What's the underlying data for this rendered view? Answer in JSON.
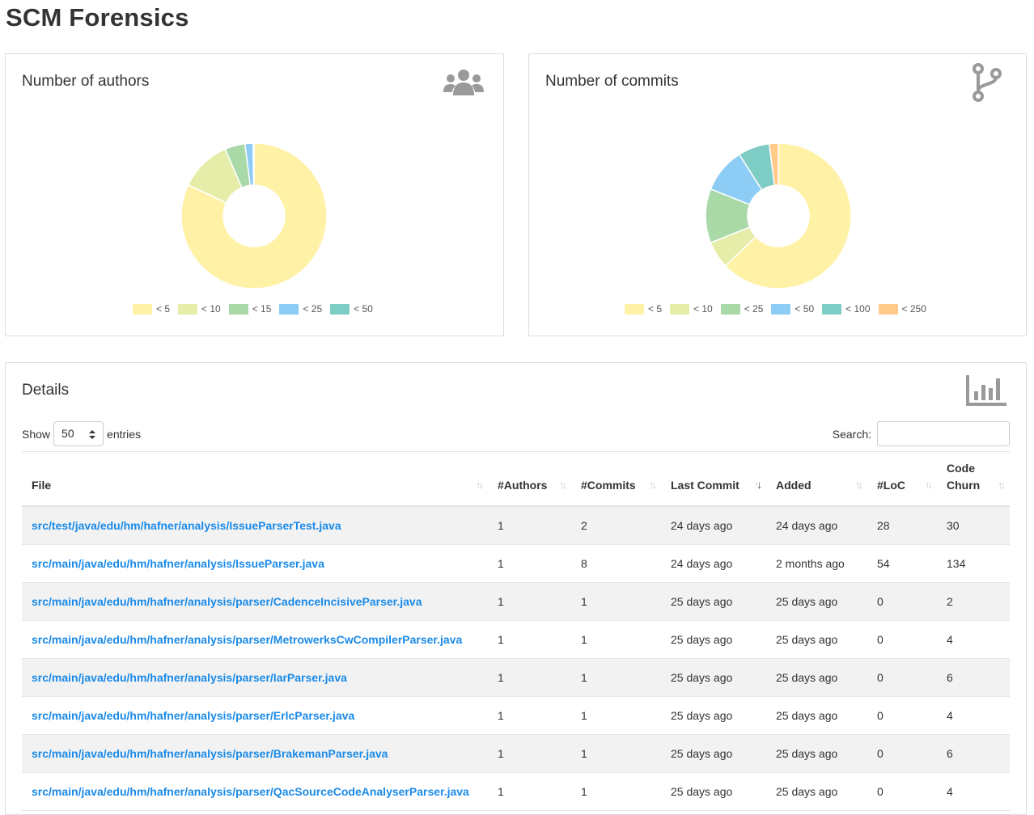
{
  "page": {
    "title": "SCM Forensics"
  },
  "authors_card": {
    "title": "Number of authors",
    "icon": "users-icon"
  },
  "commits_card": {
    "title": "Number of commits",
    "icon": "code-branch-icon"
  },
  "details_card": {
    "title": "Details",
    "icon": "bar-chart-icon",
    "show_label": "Show",
    "entries_value": "50",
    "entries_label": "entries",
    "search_label": "Search:",
    "search_value": ""
  },
  "chart_data": [
    {
      "type": "pie",
      "categories": [
        "< 5",
        "< 10",
        "< 15",
        "< 25",
        "< 50"
      ],
      "values": [
        82,
        11.5,
        4.5,
        1.8,
        0.2
      ],
      "colors": [
        "#fff1a6",
        "#e6eda8",
        "#a9d9a6",
        "#8dcdf5",
        "#7dcdc4"
      ]
    },
    {
      "type": "pie",
      "categories": [
        "< 5",
        "< 10",
        "< 25",
        "< 50",
        "< 100",
        "< 250"
      ],
      "values": [
        63,
        6,
        12,
        10,
        7,
        2
      ],
      "colors": [
        "#fff1a6",
        "#e6eda8",
        "#a9d9a6",
        "#8dcdf5",
        "#7dcdc4",
        "#ffc98a"
      ]
    }
  ],
  "table": {
    "columns": [
      "File",
      "#Authors",
      "#Commits",
      "Last Commit",
      "Added",
      "#LoC",
      "Code Churn"
    ],
    "rows": [
      [
        "src/test/java/edu/hm/hafner/analysis/IssueParserTest.java",
        "1",
        "2",
        "24 days ago",
        "24 days ago",
        "28",
        "30"
      ],
      [
        "src/main/java/edu/hm/hafner/analysis/IssueParser.java",
        "1",
        "8",
        "24 days ago",
        "2 months ago",
        "54",
        "134"
      ],
      [
        "src/main/java/edu/hm/hafner/analysis/parser/CadenceIncisiveParser.java",
        "1",
        "1",
        "25 days ago",
        "25 days ago",
        "0",
        "2"
      ],
      [
        "src/main/java/edu/hm/hafner/analysis/parser/MetrowerksCwCompilerParser.java",
        "1",
        "1",
        "25 days ago",
        "25 days ago",
        "0",
        "4"
      ],
      [
        "src/main/java/edu/hm/hafner/analysis/parser/IarParser.java",
        "1",
        "1",
        "25 days ago",
        "25 days ago",
        "0",
        "6"
      ],
      [
        "src/main/java/edu/hm/hafner/analysis/parser/ErlcParser.java",
        "1",
        "1",
        "25 days ago",
        "25 days ago",
        "0",
        "4"
      ],
      [
        "src/main/java/edu/hm/hafner/analysis/parser/BrakemanParser.java",
        "1",
        "1",
        "25 days ago",
        "25 days ago",
        "0",
        "6"
      ],
      [
        "src/main/java/edu/hm/hafner/analysis/parser/QacSourceCodeAnalyserParser.java",
        "1",
        "1",
        "25 days ago",
        "25 days ago",
        "0",
        "4"
      ]
    ]
  }
}
